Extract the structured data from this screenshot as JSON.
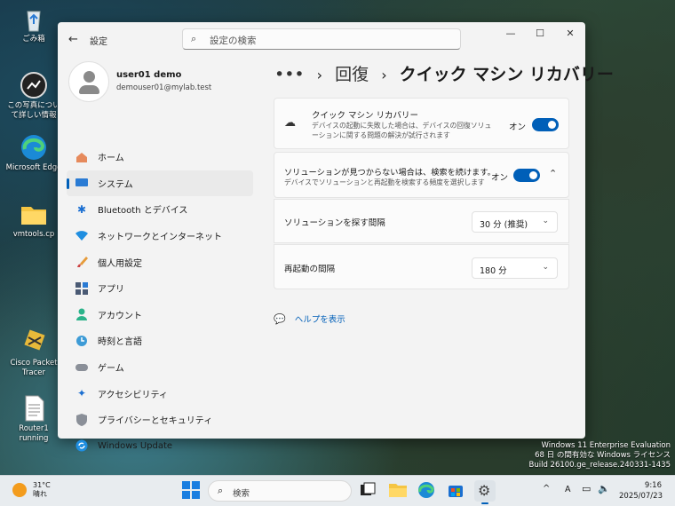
{
  "desktop": {
    "icons": [
      {
        "label": "ごみ箱",
        "icon": "recycle-bin-icon"
      },
      {
        "label": "この写真について詳しい情報",
        "icon": "info-icon"
      },
      {
        "label": "Microsoft Edge",
        "icon": "edge-icon"
      },
      {
        "label": "vmtools.cp",
        "icon": "folder-icon"
      },
      {
        "label": "Cisco Packet Tracer",
        "icon": "packet-tracer-icon"
      },
      {
        "label": "Router1 running",
        "icon": "text-file-icon"
      }
    ],
    "watermark": [
      "Windows 11 Enterprise Evaluation",
      "68 日 の間有効な Windows ライセンス",
      "Build 26100.ge_release.240331-1435"
    ]
  },
  "window": {
    "title": "設定",
    "search_placeholder": "設定の検索",
    "controls": {
      "minimize": "—",
      "maximize": "☐",
      "close": "✕"
    }
  },
  "profile": {
    "name": "user01 demo",
    "email": "demouser01@mylab.test"
  },
  "nav": [
    {
      "label": "ホーム",
      "icon": "home-icon"
    },
    {
      "label": "システム",
      "icon": "system-icon",
      "active": true
    },
    {
      "label": "Bluetooth とデバイス",
      "icon": "bluetooth-icon"
    },
    {
      "label": "ネットワークとインターネット",
      "icon": "network-icon"
    },
    {
      "label": "個人用設定",
      "icon": "brush-icon"
    },
    {
      "label": "アプリ",
      "icon": "apps-icon"
    },
    {
      "label": "アカウント",
      "icon": "account-icon"
    },
    {
      "label": "時刻と言語",
      "icon": "clock-icon"
    },
    {
      "label": "ゲーム",
      "icon": "gamepad-icon"
    },
    {
      "label": "アクセシビリティ",
      "icon": "accessibility-icon"
    },
    {
      "label": "プライバシーとセキュリティ",
      "icon": "shield-icon"
    },
    {
      "label": "Windows Update",
      "icon": "update-icon"
    }
  ],
  "breadcrumb": {
    "more": "•••",
    "sep": "›",
    "parent": "回復",
    "current": "クイック マシン リカバリー"
  },
  "settings": {
    "qmr": {
      "title": "クイック マシン リカバリー",
      "desc": "デバイスの起動に失敗した場合は、デバイスの回復ソリューションに関する問題の解決が試行されます",
      "state": "オン",
      "on": true
    },
    "continue": {
      "title": "ソリューションが見つからない場合は、検索を続けます。",
      "desc": "デバイスでソリューションと再起動を検索する頻度を選択します",
      "state": "オン",
      "on": true
    },
    "interval": {
      "label": "ソリューションを探す間隔",
      "value": "30 分 (推奨)"
    },
    "restart": {
      "label": "再起動の間隔",
      "value": "180 分"
    },
    "help": "ヘルプを表示"
  },
  "taskbar": {
    "weather": {
      "temp": "31°C",
      "cond": "晴れ"
    },
    "search_placeholder": "検索",
    "time": "9:16",
    "date": "2025/07/23",
    "tray_arrow": "^",
    "ime": "A"
  }
}
